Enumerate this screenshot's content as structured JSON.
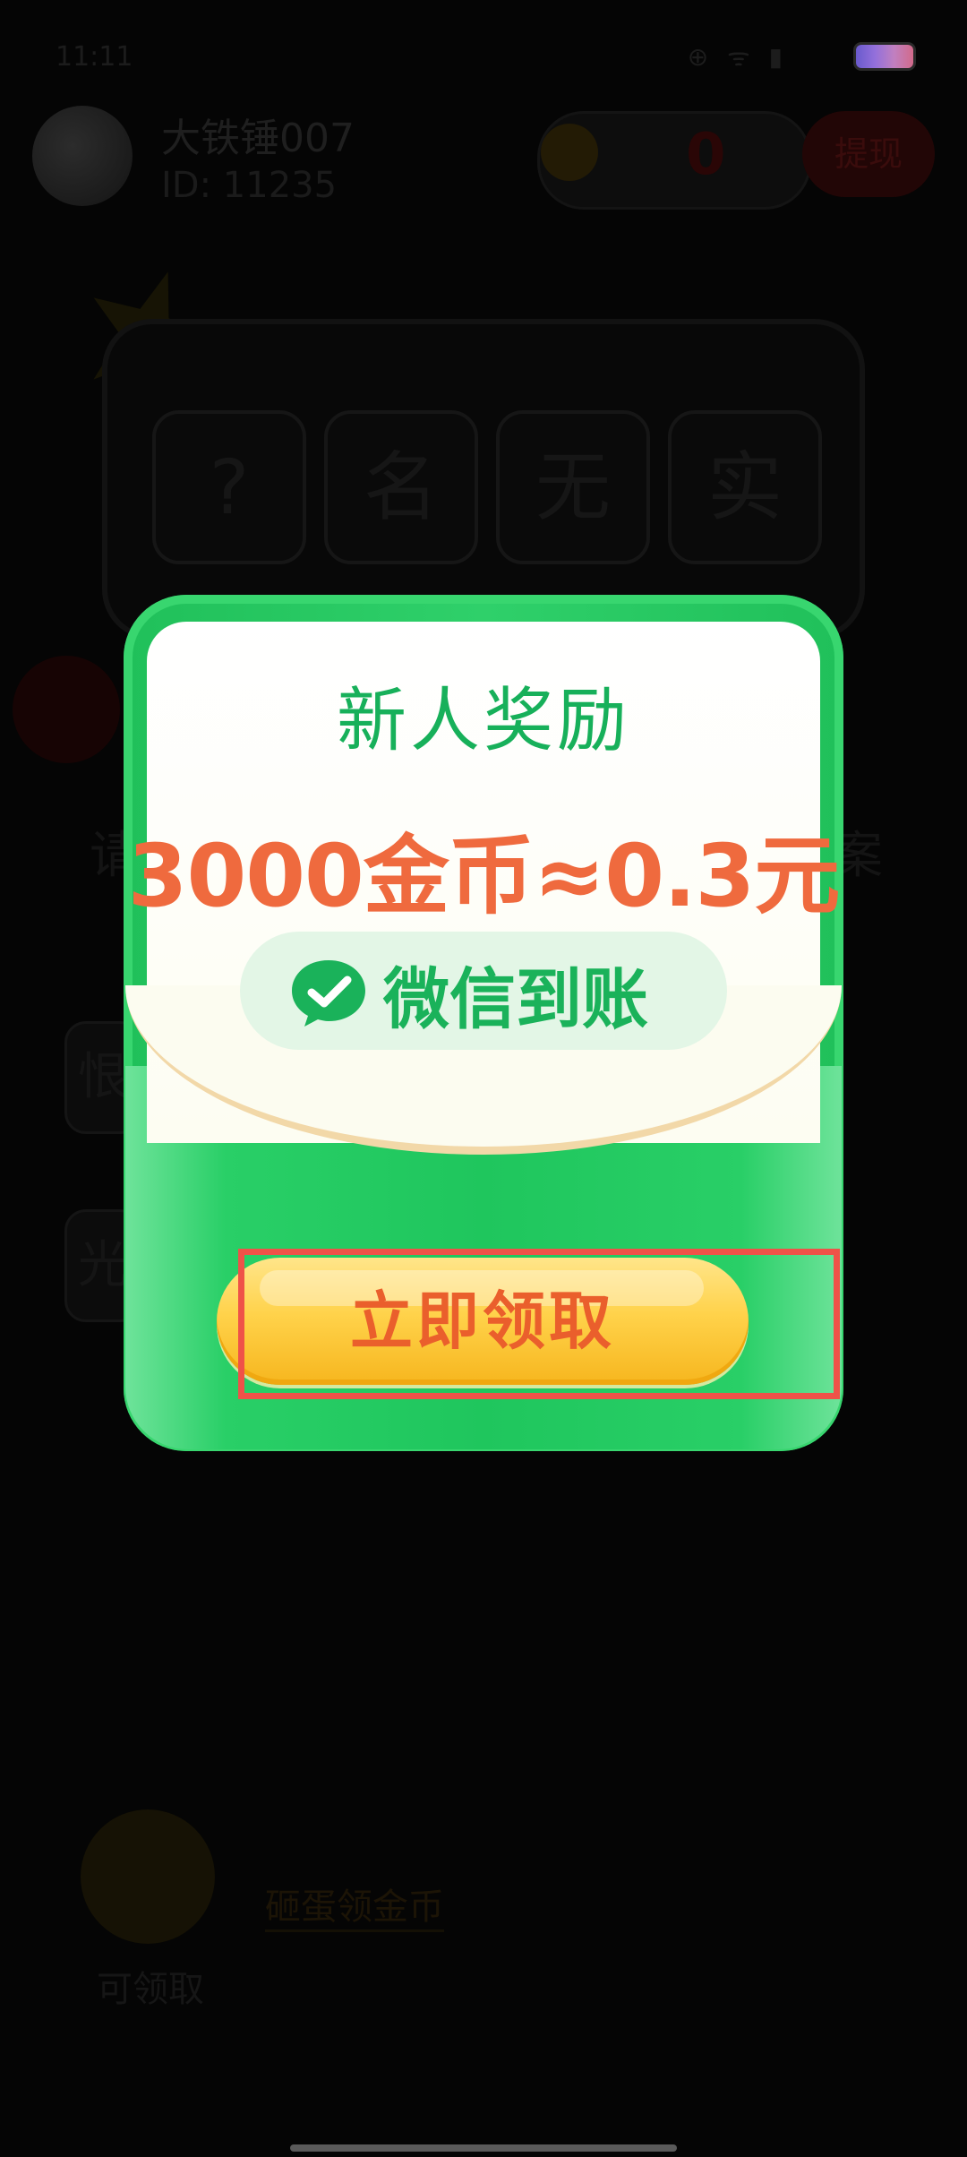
{
  "status_bar": {
    "time": "11:11",
    "icons": "⊕ ᯤ ▮"
  },
  "user": {
    "name": "大铁锤007",
    "id_text": "ID: 11235"
  },
  "coins": {
    "value": "0",
    "withdraw_label": "提现"
  },
  "idiom_board": {
    "chars": [
      "?",
      "名",
      "无",
      "实"
    ]
  },
  "question": {
    "prefix": "请",
    "suffix": "案"
  },
  "options": {
    "left_chars": [
      "恨",
      "光"
    ]
  },
  "bottom": {
    "link_text": "砸蛋领金币",
    "sub_text": "可领取"
  },
  "popup": {
    "title": "新人奖励",
    "amount": "3000金币≈0.3元",
    "wechat_label": "微信到账",
    "claim_label": "立即领取"
  },
  "colors": {
    "popup_green": "#20c05a",
    "title_green": "#17b05a",
    "amount_orange": "#ef6a3e",
    "button_yellow": "#ffd24a",
    "highlight_red": "#ef5248"
  }
}
